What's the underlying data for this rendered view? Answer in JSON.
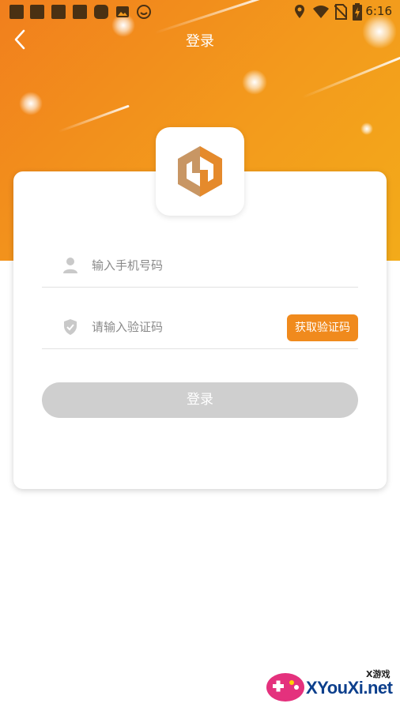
{
  "statusbar": {
    "time": "6:16"
  },
  "header": {
    "title": "登录"
  },
  "form": {
    "phone_placeholder": "输入手机号码",
    "code_placeholder": "请输入验证码",
    "get_code_label": "获取验证码",
    "login_label": "登录"
  },
  "watermark": {
    "brand": "XYouXi.net",
    "tag": "X游戏"
  },
  "colors": {
    "accent": "#f08a1d",
    "hero_start": "#f17f1d",
    "hero_end": "#f3ab1a",
    "button_disabled": "#cfcfcf"
  }
}
